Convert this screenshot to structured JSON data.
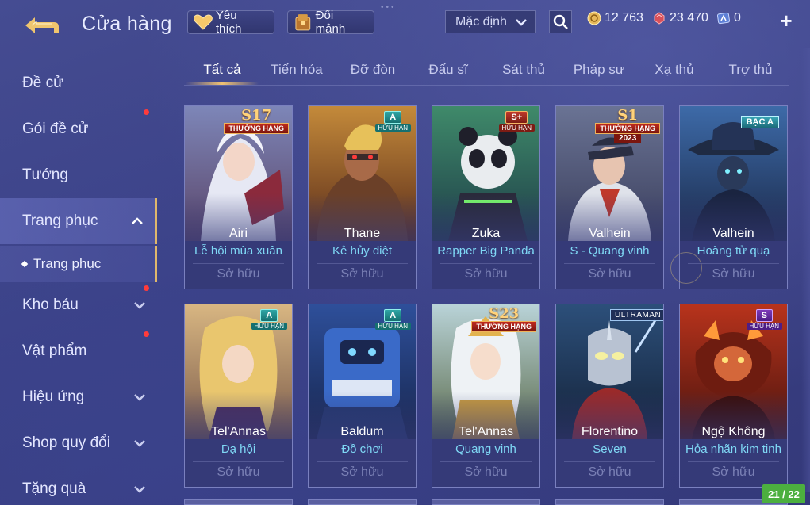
{
  "header": {
    "title": "Cửa hàng",
    "favorites_label": "Yêu thích",
    "fragments_label": "Đổi mảnh",
    "sort_value": "Mặc định",
    "currencies": {
      "gold": "12 763",
      "ruby": "23 470",
      "voucher": "0"
    },
    "plus_label": "+"
  },
  "sidebar": {
    "items": [
      {
        "label": "Đề cử"
      },
      {
        "label": "Gói đề cử"
      },
      {
        "label": "Tướng"
      },
      {
        "label": "Trang phục"
      },
      {
        "label": "Kho báu"
      },
      {
        "label": "Vật phẩm"
      },
      {
        "label": "Hiệu ứng"
      },
      {
        "label": "Shop quy đổi"
      },
      {
        "label": "Tặng quà"
      }
    ],
    "sub_item": "Trang phục"
  },
  "tabs": [
    "Tất cả",
    "Tiến hóa",
    "Đỡ đòn",
    "Đấu sĩ",
    "Sát thủ",
    "Pháp sư",
    "Xạ thủ",
    "Trợ thủ"
  ],
  "cards": [
    {
      "hero": "Airi",
      "skin": "Lễ hội mùa xuân",
      "status": "Sở hữu",
      "badge_main": "S17",
      "badge_sub": "THƯỜNG HẠNG"
    },
    {
      "hero": "Thane",
      "skin": "Kẻ hủy diệt",
      "status": "Sở hữu",
      "badge_main": "A",
      "badge_sub": "HỮU HẠN"
    },
    {
      "hero": "Zuka",
      "skin": "Rapper Big Panda",
      "status": "Sở hữu",
      "badge_main": "S+",
      "badge_sub": "HỮU HẠN"
    },
    {
      "hero": "Valhein",
      "skin": "S - Quang vinh",
      "status": "Sở hữu",
      "badge_main": "S1",
      "badge_sub": "THƯỜNG HẠNG",
      "badge_year": "2023"
    },
    {
      "hero": "Valhein",
      "skin": "Hoàng tử quạ",
      "status": "Sở hữu",
      "badge_main": "BẠC A"
    },
    {
      "hero": "Tel'Annas",
      "skin": "Dạ hội",
      "status": "Sở hữu",
      "badge_main": "A",
      "badge_sub": "HỮU HẠN"
    },
    {
      "hero": "Baldum",
      "skin": "Đồ chơi",
      "status": "Sở hữu",
      "badge_main": "A",
      "badge_sub": "HỮU HẠN"
    },
    {
      "hero": "Tel'Annas",
      "skin": "Quang vinh",
      "status": "Sở hữu",
      "badge_main": "S23",
      "badge_sub": "THƯỜNG HẠNG"
    },
    {
      "hero": "Florentino",
      "skin": "Seven",
      "status": "Sở hữu",
      "badge_main": "ULTRAMAN"
    },
    {
      "hero": "Ngộ Không",
      "skin": "Hỏa nhãn kim tinh",
      "status": "Sở hữu",
      "badge_main": "S",
      "badge_sub": "HỮU HẠN"
    }
  ],
  "page_counter": "21 / 22",
  "colors": {
    "background": "#3b4185",
    "accent_gold": "#f1c272",
    "skin_name": "#7fd8f5",
    "notification_dot": "#ff3b3b",
    "page_counter": "#4caf3f"
  },
  "icons": [
    "back-arrow-icon",
    "heart-icon",
    "fragment-chest-icon",
    "chevron-down-icon",
    "search-icon",
    "gold-coin-icon",
    "ruby-gem-icon",
    "voucher-icon",
    "plus-icon",
    "chevron-up-icon"
  ]
}
